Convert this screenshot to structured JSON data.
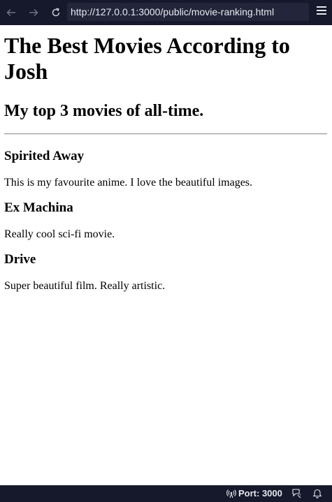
{
  "browser": {
    "url": "http://127.0.0.1:3000/public/movie-ranking.html",
    "back_icon": "arrow-left-icon",
    "forward_icon": "arrow-right-icon",
    "reload_icon": "reload-icon",
    "menu_icon": "hamburger-menu-icon"
  },
  "page": {
    "title": "The Best Movies According to Josh",
    "subtitle": "My top 3 movies of all-time.",
    "movies": [
      {
        "name": "Spirited Away",
        "description": "This is my favourite anime. I love the beautiful images."
      },
      {
        "name": "Ex Machina",
        "description": "Really cool sci-fi movie."
      },
      {
        "name": "Drive",
        "description": "Super beautiful film. Really artistic."
      }
    ]
  },
  "status_bar": {
    "port_label": "Port: 3000",
    "broadcast_icon": "broadcast-icon",
    "feedback_icon": "feedback-icon",
    "bell_icon": "bell-icon"
  }
}
